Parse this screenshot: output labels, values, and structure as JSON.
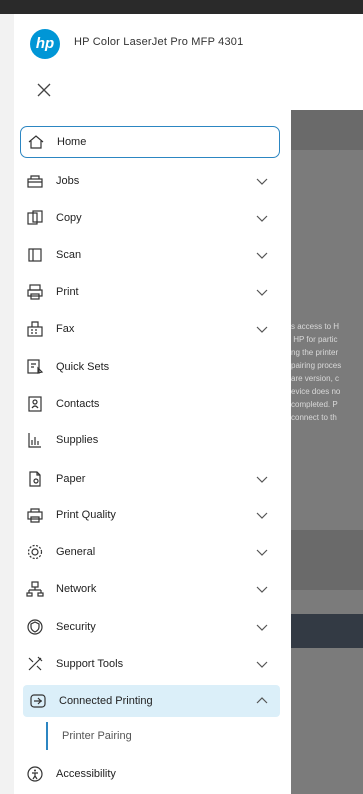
{
  "app": {
    "title": "HP Color LaserJet Pro MFP 4301",
    "logo_text": "hp"
  },
  "close_label": "Close",
  "nav": {
    "items": [
      {
        "label": "Home",
        "icon": "home-icon",
        "chevron": "none",
        "state": "selected"
      },
      {
        "label": "Jobs",
        "icon": "jobs-icon",
        "chevron": "down",
        "state": "normal"
      },
      {
        "label": "Copy",
        "icon": "copy-icon",
        "chevron": "down",
        "state": "normal"
      },
      {
        "label": "Scan",
        "icon": "scan-icon",
        "chevron": "down",
        "state": "normal"
      },
      {
        "label": "Print",
        "icon": "print-icon",
        "chevron": "down",
        "state": "normal"
      },
      {
        "label": "Fax",
        "icon": "fax-icon",
        "chevron": "down",
        "state": "normal"
      },
      {
        "label": "Quick Sets",
        "icon": "quick-sets-icon",
        "chevron": "none",
        "state": "normal"
      },
      {
        "label": "Contacts",
        "icon": "contacts-icon",
        "chevron": "none",
        "state": "normal"
      },
      {
        "label": "Supplies",
        "icon": "supplies-icon",
        "chevron": "none",
        "state": "normal"
      },
      {
        "label": "Paper",
        "icon": "paper-icon",
        "chevron": "down",
        "state": "normal"
      },
      {
        "label": "Print Quality",
        "icon": "print-quality-icon",
        "chevron": "down",
        "state": "normal"
      },
      {
        "label": "General",
        "icon": "general-icon",
        "chevron": "down",
        "state": "normal"
      },
      {
        "label": "Network",
        "icon": "network-icon",
        "chevron": "down",
        "state": "normal"
      },
      {
        "label": "Security",
        "icon": "security-icon",
        "chevron": "down",
        "state": "normal"
      },
      {
        "label": "Support Tools",
        "icon": "support-tools-icon",
        "chevron": "down",
        "state": "normal"
      },
      {
        "label": "Connected Printing",
        "icon": "connected-printing-icon",
        "chevron": "up",
        "state": "expanded"
      },
      {
        "label": "Accessibility",
        "icon": "accessibility-icon",
        "chevron": "none",
        "state": "normal"
      }
    ],
    "subitem": {
      "label": "Printer Pairing"
    }
  },
  "background_text": "s access to H\n HP for partic\nng the printer\npairing proces\nare version, c\nevice does no\ncompleted. P\nconnect to th",
  "colors": {
    "accent": "#2c86c2",
    "expanded_bg": "#dbeff9",
    "hp_blue": "#0096d6",
    "backdrop": "#7b7b7b"
  }
}
